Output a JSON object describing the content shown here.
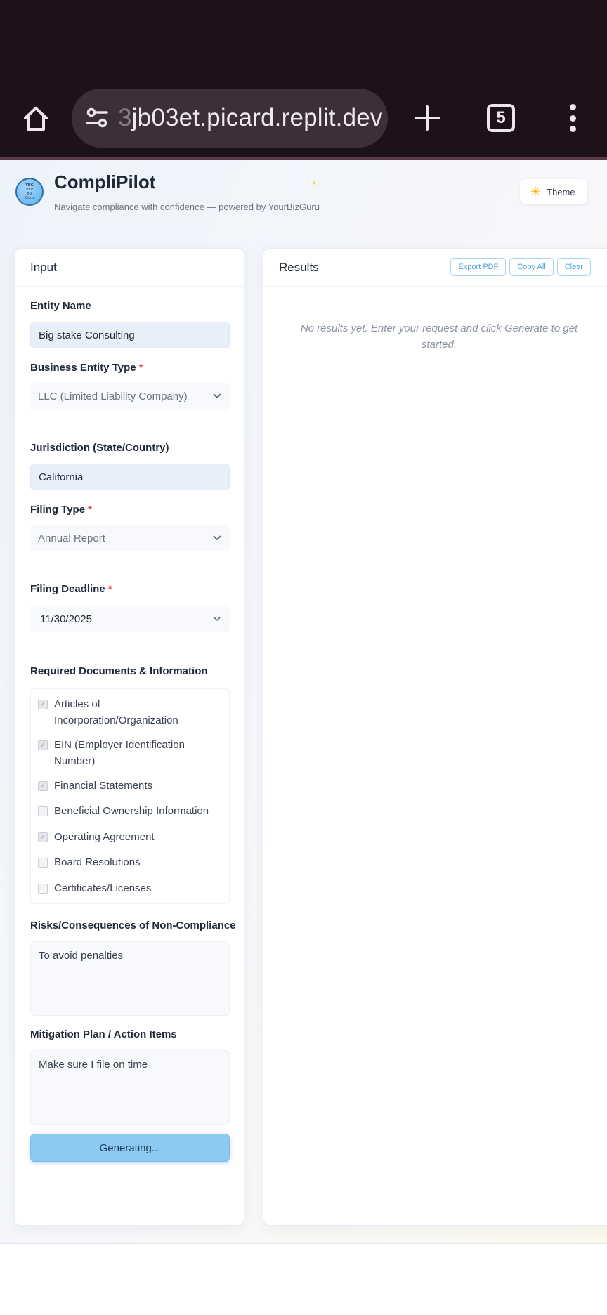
{
  "browser": {
    "url_faded": "3",
    "url_main": "jb03et.picard.replit.dev",
    "tab_count": "5",
    "icons": [
      "home-icon",
      "site-settings-icon",
      "plus-icon",
      "tabs-icon",
      "more-vert-icon"
    ]
  },
  "header": {
    "logo_lines": [
      "YBG",
      "Your",
      "Biz",
      "Guru"
    ],
    "title": "CompliPilot",
    "tagline": "Navigate compliance with confidence — powered by YourBizGuru",
    "theme_label": "Theme"
  },
  "input_panel": {
    "title": "Input",
    "entity_name": {
      "label": "Entity Name",
      "value": "Big stake Consulting"
    },
    "entity_type": {
      "label": "Business Entity Type",
      "required": "*",
      "value": "LLC (Limited Liability Company)"
    },
    "jurisdiction": {
      "label": "Jurisdiction (State/Country)",
      "value": "California"
    },
    "filing_type": {
      "label": "Filing Type",
      "required": "*",
      "value": "Annual Report"
    },
    "filing_deadline": {
      "label": "Filing Deadline",
      "required": "*",
      "value": "11/30/2025"
    },
    "documents": {
      "label": "Required Documents & Information",
      "items": [
        {
          "label": "Articles of Incorporation/Organization",
          "checked": true
        },
        {
          "label": "EIN (Employer Identification Number)",
          "checked": true
        },
        {
          "label": "Financial Statements",
          "checked": true
        },
        {
          "label": "Beneficial Ownership Information",
          "checked": false
        },
        {
          "label": "Operating Agreement",
          "checked": true
        },
        {
          "label": "Board Resolutions",
          "checked": false
        },
        {
          "label": "Certificates/Licenses",
          "checked": false
        }
      ]
    },
    "risks": {
      "label": "Risks/Consequences of Non-Compliance",
      "value": "To avoid penalties"
    },
    "mitigation": {
      "label": "Mitigation Plan / Action Items",
      "value": "Make sure I file on time"
    },
    "generate_label": "Generating..."
  },
  "results_panel": {
    "title": "Results",
    "export_label": "Export PDF",
    "copy_label": "Copy All",
    "clear_label": "Clear",
    "empty_message": "No results yet. Enter your request and click Generate to get started."
  }
}
